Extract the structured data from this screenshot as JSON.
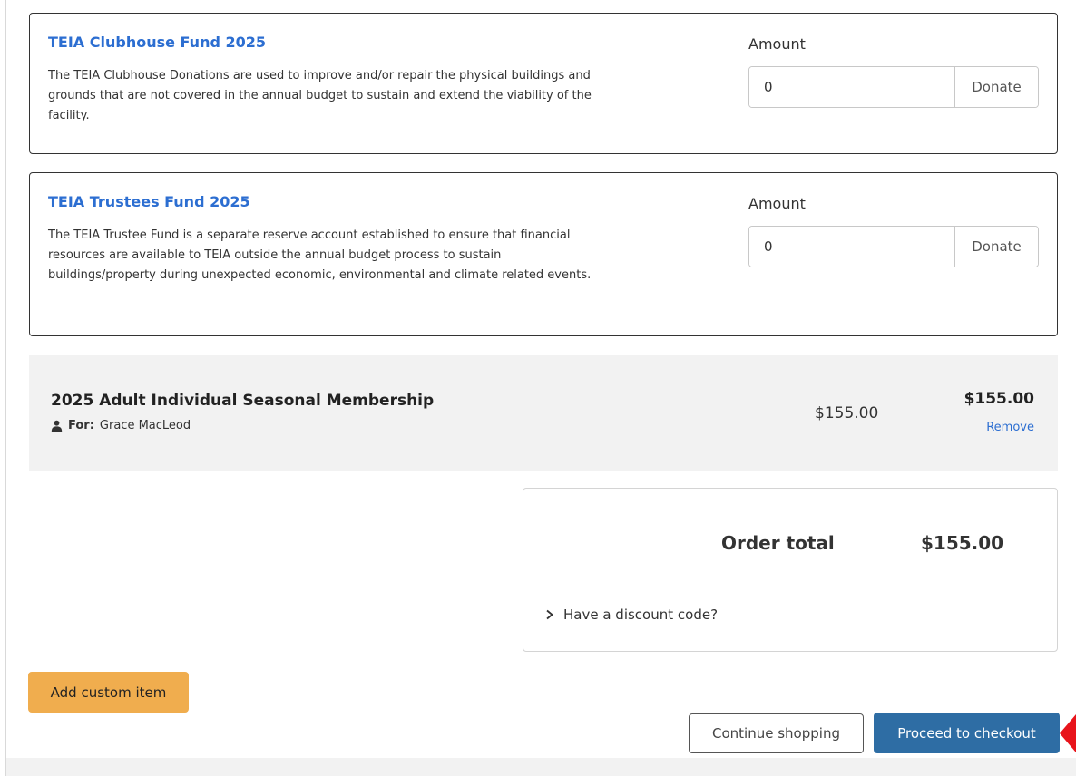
{
  "funds": [
    {
      "title": "TEIA Clubhouse Fund 2025",
      "description": "The TEIA Clubhouse Donations are used to improve and/or repair the physical buildings and grounds that are not covered in the annual budget to sustain and extend the viability of the facility.",
      "amount_label": "Amount",
      "amount_value": "0",
      "donate_label": "Donate"
    },
    {
      "title": "TEIA Trustees Fund 2025",
      "description": "The TEIA Trustee Fund is a separate reserve account established to ensure that financial resources are available to TEIA outside the annual budget process to sustain buildings/property during unexpected economic, environmental and climate related events.",
      "amount_label": "Amount",
      "amount_value": "0",
      "donate_label": "Donate"
    }
  ],
  "cart_item": {
    "name": "2025 Adult Individual Seasonal Membership",
    "for_label": "For:",
    "for_name": "Grace MacLeod",
    "unit_price": "$155.00",
    "line_total": "$155.00",
    "remove_label": "Remove"
  },
  "summary": {
    "order_total_label": "Order total",
    "order_total_value": "$155.00",
    "discount_label": "Have a discount code?"
  },
  "actions": {
    "add_custom_item": "Add custom item",
    "continue_shopping": "Continue shopping",
    "proceed_to_checkout": "Proceed to checkout"
  },
  "colors": {
    "link": "#2c6ed1",
    "primary": "#2e6da4",
    "warning": "#f0ad4e",
    "pointer": "#e8141b"
  }
}
